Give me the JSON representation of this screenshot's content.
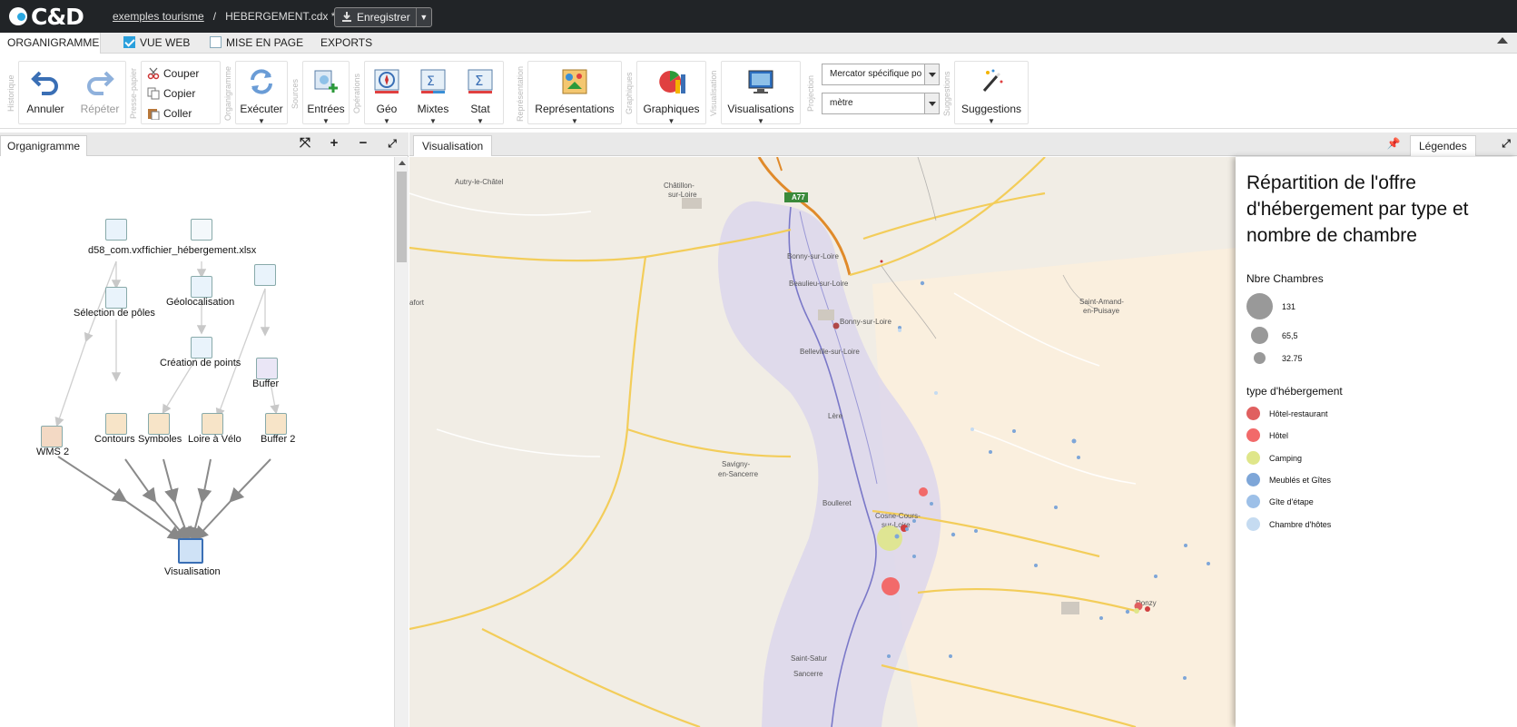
{
  "app": {
    "logo": "C&D"
  },
  "breadcrumb": {
    "project": "exemples tourisme",
    "separator": "/",
    "file": "HEBERGEMENT.cdx *"
  },
  "save_button": {
    "label": "Enregistrer"
  },
  "tabs": [
    {
      "label": "ORGANIGRAMME"
    },
    {
      "label": "VUE WEB",
      "checked": true
    },
    {
      "label": "MISE EN PAGE",
      "checked": false
    },
    {
      "label": "EXPORTS"
    }
  ],
  "ribbon": {
    "groups": {
      "historique": "Historique",
      "presse": "Presse-papier",
      "organigramme": "Organigramme",
      "sources": "Sources",
      "operations": "Opérations",
      "representations": "Représentation",
      "graphiques": "Graphiques",
      "visualisations": "Visualisation",
      "projection": "Projection",
      "suggestions": "Suggestions"
    },
    "annuler": "Annuler",
    "repeter": "Répéter",
    "couper": "Couper",
    "copier": "Copier",
    "coller": "Coller",
    "executer": "Exécuter",
    "entrees": "Entrées",
    "geo": "Géo",
    "mixtes": "Mixtes",
    "stat": "Stat",
    "representations_btn": "Représentations",
    "graphiques_btn": "Graphiques",
    "visualisations_btn": "Visualisations",
    "projection_select": "Mercator spécifique po",
    "unit_select": "mètre",
    "suggestions_btn": "Suggestions"
  },
  "left_panel": {
    "title": "Organigramme",
    "nodes": {
      "d58": "d58_com.vxf",
      "fichier": "fichier_hébergement.xlsx",
      "selection": "Sélection de pôles",
      "geoloc": "Géolocalisation",
      "creation": "Création de points",
      "buffer": "Buffer",
      "wms": "WMS 2",
      "contours": "Contours",
      "symboles": "Symboles",
      "loire": "Loire à Vélo",
      "buffer2": "Buffer 2",
      "visualisation": "Visualisation"
    }
  },
  "right_panel": {
    "title": "Visualisation",
    "legend_tab": "Légendes"
  },
  "map": {
    "places": {
      "autry": "Autry-le-Châtel",
      "chatillon1": "Châtillon-",
      "chatillon2": "sur-Loire",
      "bonny": "Bonny-sur-Loire",
      "beaulieu": "Beaulieu-sur-Loire",
      "bonnycity": "Bonny-sur-Loire",
      "belleville": "Belleville-sur-Loire",
      "lafort": "afort",
      "saintamand1": "Saint-Amand-",
      "saintamand2": "en-Puisaye",
      "lere": "Lère",
      "savigny1": "Savigny-",
      "savigny2": "en-Sancerre",
      "boulleret": "Boulleret",
      "cosne1": "Cosne-Cours-",
      "cosne2": "sur-Loire",
      "donzy": "Donzy",
      "saintsatur": "Saint-Satur",
      "sancerre": "Sancerre"
    },
    "highway": "A77"
  },
  "legend": {
    "title": "Répartition de l'offre d'hébergement par type et nombre de chambre",
    "size_title": "Nbre Chambres",
    "sizes": [
      {
        "label": "131"
      },
      {
        "label": "65,5"
      },
      {
        "label": "32.75"
      }
    ],
    "type_title": "type d'hébergement",
    "types": [
      {
        "label": "Hôtel-restaurant",
        "color": "#e06060"
      },
      {
        "label": "Hôtel",
        "color": "#f26a6a"
      },
      {
        "label": "Camping",
        "color": "#dfe68a"
      },
      {
        "label": "Meublés et Gîtes",
        "color": "#7ea6d8"
      },
      {
        "label": "Gîte d'étape",
        "color": "#9dc0e8"
      },
      {
        "label": "Chambre d'hôtes",
        "color": "#c5dbf1"
      }
    ]
  }
}
